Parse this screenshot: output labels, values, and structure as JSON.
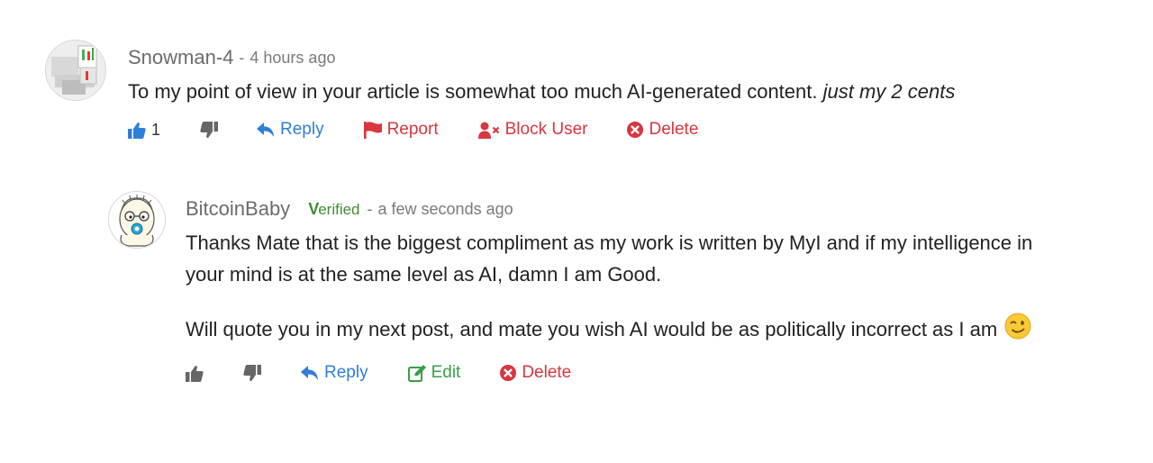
{
  "comments": [
    {
      "author": "Snowman-4",
      "separator": "-",
      "time": "4 hours ago",
      "text": "To my point of view in your article is somewhat too much AI-generated content.",
      "text_italic": "just my 2 cents",
      "actions": {
        "like_count": "1",
        "reply": "Reply",
        "report": "Report",
        "block": "Block User",
        "delete": "Delete"
      }
    },
    {
      "author": "BitcoinBaby",
      "verified": "erified",
      "verified_mark": "V",
      "separator": "-",
      "time": "a few seconds ago",
      "paragraph1": "Thanks Mate that is the biggest compliment as my work is written by MyI and if my intelligence in your mind is at the same level as AI, damn I am Good.",
      "paragraph2": "Will quote you in my next post, and mate you wish AI would be as politically incorrect as I am",
      "actions": {
        "reply": "Reply",
        "edit": "Edit",
        "delete": "Delete"
      }
    }
  ],
  "colors": {
    "reply": "#2f7ed8",
    "danger": "#d9363e",
    "edit": "#37a047",
    "verified": "#3c8f2e"
  }
}
